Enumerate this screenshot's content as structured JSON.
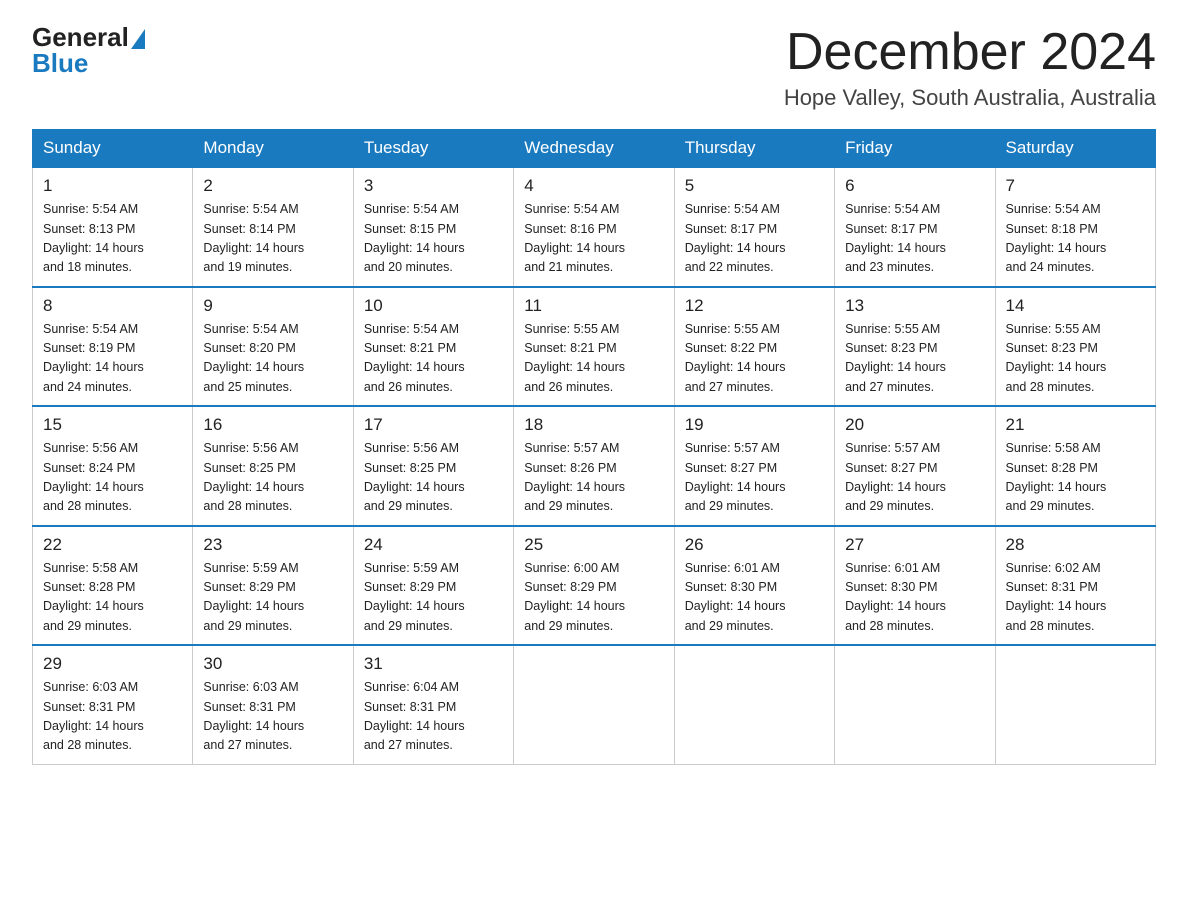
{
  "header": {
    "logo_general": "General",
    "logo_blue": "Blue",
    "month": "December 2024",
    "location": "Hope Valley, South Australia, Australia"
  },
  "days_of_week": [
    "Sunday",
    "Monday",
    "Tuesday",
    "Wednesday",
    "Thursday",
    "Friday",
    "Saturday"
  ],
  "weeks": [
    [
      {
        "day": "1",
        "sunrise": "5:54 AM",
        "sunset": "8:13 PM",
        "daylight": "14 hours and 18 minutes."
      },
      {
        "day": "2",
        "sunrise": "5:54 AM",
        "sunset": "8:14 PM",
        "daylight": "14 hours and 19 minutes."
      },
      {
        "day": "3",
        "sunrise": "5:54 AM",
        "sunset": "8:15 PM",
        "daylight": "14 hours and 20 minutes."
      },
      {
        "day": "4",
        "sunrise": "5:54 AM",
        "sunset": "8:16 PM",
        "daylight": "14 hours and 21 minutes."
      },
      {
        "day": "5",
        "sunrise": "5:54 AM",
        "sunset": "8:17 PM",
        "daylight": "14 hours and 22 minutes."
      },
      {
        "day": "6",
        "sunrise": "5:54 AM",
        "sunset": "8:17 PM",
        "daylight": "14 hours and 23 minutes."
      },
      {
        "day": "7",
        "sunrise": "5:54 AM",
        "sunset": "8:18 PM",
        "daylight": "14 hours and 24 minutes."
      }
    ],
    [
      {
        "day": "8",
        "sunrise": "5:54 AM",
        "sunset": "8:19 PM",
        "daylight": "14 hours and 24 minutes."
      },
      {
        "day": "9",
        "sunrise": "5:54 AM",
        "sunset": "8:20 PM",
        "daylight": "14 hours and 25 minutes."
      },
      {
        "day": "10",
        "sunrise": "5:54 AM",
        "sunset": "8:21 PM",
        "daylight": "14 hours and 26 minutes."
      },
      {
        "day": "11",
        "sunrise": "5:55 AM",
        "sunset": "8:21 PM",
        "daylight": "14 hours and 26 minutes."
      },
      {
        "day": "12",
        "sunrise": "5:55 AM",
        "sunset": "8:22 PM",
        "daylight": "14 hours and 27 minutes."
      },
      {
        "day": "13",
        "sunrise": "5:55 AM",
        "sunset": "8:23 PM",
        "daylight": "14 hours and 27 minutes."
      },
      {
        "day": "14",
        "sunrise": "5:55 AM",
        "sunset": "8:23 PM",
        "daylight": "14 hours and 28 minutes."
      }
    ],
    [
      {
        "day": "15",
        "sunrise": "5:56 AM",
        "sunset": "8:24 PM",
        "daylight": "14 hours and 28 minutes."
      },
      {
        "day": "16",
        "sunrise": "5:56 AM",
        "sunset": "8:25 PM",
        "daylight": "14 hours and 28 minutes."
      },
      {
        "day": "17",
        "sunrise": "5:56 AM",
        "sunset": "8:25 PM",
        "daylight": "14 hours and 29 minutes."
      },
      {
        "day": "18",
        "sunrise": "5:57 AM",
        "sunset": "8:26 PM",
        "daylight": "14 hours and 29 minutes."
      },
      {
        "day": "19",
        "sunrise": "5:57 AM",
        "sunset": "8:27 PM",
        "daylight": "14 hours and 29 minutes."
      },
      {
        "day": "20",
        "sunrise": "5:57 AM",
        "sunset": "8:27 PM",
        "daylight": "14 hours and 29 minutes."
      },
      {
        "day": "21",
        "sunrise": "5:58 AM",
        "sunset": "8:28 PM",
        "daylight": "14 hours and 29 minutes."
      }
    ],
    [
      {
        "day": "22",
        "sunrise": "5:58 AM",
        "sunset": "8:28 PM",
        "daylight": "14 hours and 29 minutes."
      },
      {
        "day": "23",
        "sunrise": "5:59 AM",
        "sunset": "8:29 PM",
        "daylight": "14 hours and 29 minutes."
      },
      {
        "day": "24",
        "sunrise": "5:59 AM",
        "sunset": "8:29 PM",
        "daylight": "14 hours and 29 minutes."
      },
      {
        "day": "25",
        "sunrise": "6:00 AM",
        "sunset": "8:29 PM",
        "daylight": "14 hours and 29 minutes."
      },
      {
        "day": "26",
        "sunrise": "6:01 AM",
        "sunset": "8:30 PM",
        "daylight": "14 hours and 29 minutes."
      },
      {
        "day": "27",
        "sunrise": "6:01 AM",
        "sunset": "8:30 PM",
        "daylight": "14 hours and 28 minutes."
      },
      {
        "day": "28",
        "sunrise": "6:02 AM",
        "sunset": "8:31 PM",
        "daylight": "14 hours and 28 minutes."
      }
    ],
    [
      {
        "day": "29",
        "sunrise": "6:03 AM",
        "sunset": "8:31 PM",
        "daylight": "14 hours and 28 minutes."
      },
      {
        "day": "30",
        "sunrise": "6:03 AM",
        "sunset": "8:31 PM",
        "daylight": "14 hours and 27 minutes."
      },
      {
        "day": "31",
        "sunrise": "6:04 AM",
        "sunset": "8:31 PM",
        "daylight": "14 hours and 27 minutes."
      },
      null,
      null,
      null,
      null
    ]
  ],
  "labels": {
    "sunrise": "Sunrise:",
    "sunset": "Sunset:",
    "daylight": "Daylight:"
  }
}
